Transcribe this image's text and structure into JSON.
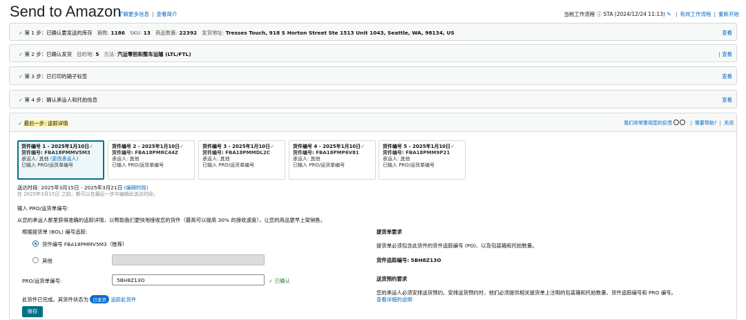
{
  "header": {
    "title": "Send to Amazon",
    "link_learn": "了解更多信息",
    "link_intro": "查看简介",
    "workflow_prefix": "当前工作流程",
    "workflow_value": "STA (2024/12/24 11:13)",
    "link_valid_workflows": "有效工作流程",
    "link_restart": "重新开始"
  },
  "steps": [
    {
      "label": "第 1 步：已确认要发送的库存",
      "meta1_key": "箱数:",
      "meta1_val": "1186",
      "meta2_key": "SKU:",
      "meta2_val": "13",
      "meta3_key": "商品数量:",
      "meta3_val": "22392",
      "meta4_key": "发货地址:",
      "meta4_val": "Tresses Touch, 918 S Horton Street Ste 1513 Unit 1043, Seattle, WA, 98134, US",
      "view": "查看"
    },
    {
      "label": "第 2 步：已确认发货",
      "meta1_key": "目的地:",
      "meta1_val": "5",
      "meta2_key": "方法:",
      "meta2_val": "汽运零担和整车运输 (LTL/FTL)",
      "view": "查看"
    },
    {
      "label": "第 3 步：已打印的箱子标签",
      "view": "查看"
    },
    {
      "label": "第 4 步：确认承运人和托拍信息",
      "view": "查看"
    }
  ],
  "last_step": {
    "label": "最后一步: 追踪详情",
    "feedback": "我们非常重视您的反馈",
    "need_help": "需要帮助?",
    "close": "关闭"
  },
  "shipments": [
    {
      "title": "货件编号 1 - 2025年1月10日",
      "id": "货件编号: FBA18PMMV5M3",
      "carrier": "承运人: 其他",
      "change": "(更改承运人)",
      "status": "已输入 PRO/运货单编号"
    },
    {
      "title": "货件编号 2 - 2025年1月10日",
      "id": "货件编号: FBA18PMRC44Z",
      "carrier": "承运人: 其他",
      "status": "已输入 PRO/运货单编号"
    },
    {
      "title": "货件编号 3 - 2025年1月10日",
      "id": "货件编号: FBA18PMMDL2C",
      "carrier": "承运人: 其他",
      "status": "已输入 PRO/运货单编号"
    },
    {
      "title": "货件编号 4 - 2025年1月10日",
      "id": "货件编号: FBA18PMP6V81",
      "carrier": "承运人: 其他",
      "status": "已输入 PRO/运货单编号"
    },
    {
      "title": "货件编号 5 - 2025年1月10日",
      "id": "货件编号: FBA18PMM9P21",
      "carrier": "承运人: 其他",
      "status": "已输入 PRO/运货单编号"
    }
  ],
  "delivery": {
    "window": "送达时段: 2025年3月15日 - 2025年3月21日",
    "edit_link": "(编辑时段)",
    "note": "在 2025年3月15日 之前，都可以在最后一步中编辑此送达时段。"
  },
  "form": {
    "pro_heading": "输入 PRO/运货单编号:",
    "info": "从您的承运人那里获得准确的追踪详情，以帮助我们更快地接收您的货件（最高可以提高 30% 的接收速度），让您的商品更早上架销售。",
    "bol_label": "根据提货单 (BOL) 编号追踪:",
    "radio1_label": "货件编号 FBA18PMMV5M3（推荐）",
    "radio2_label": "其他",
    "pro_label": "PRO/运货单编号:",
    "pro_value": "5BH8Z13O",
    "confirmed": "已确认",
    "status_text": "此货件已完成。其货件状态为",
    "status_badge": "已发货",
    "track_link": "追踪此货件",
    "save": "保存"
  },
  "requirements": {
    "bol_title": "提货单要求",
    "bol_desc": "提货单必须包含此货件的货件追踪编号 (PO)、以及包装箱和托拍数量。",
    "tracking_label": "货件追踪编号:",
    "tracking_value": "5BH8Z13O",
    "appt_title": "送货预约要求",
    "appt_desc": "您的承运人必须安排送货预约。安排送货预约时，他们必须提供相关提货单上注明的包装箱和托拍数量、货件追踪编号和 PRO 编号。",
    "appt_link": "查看详细的说明"
  }
}
